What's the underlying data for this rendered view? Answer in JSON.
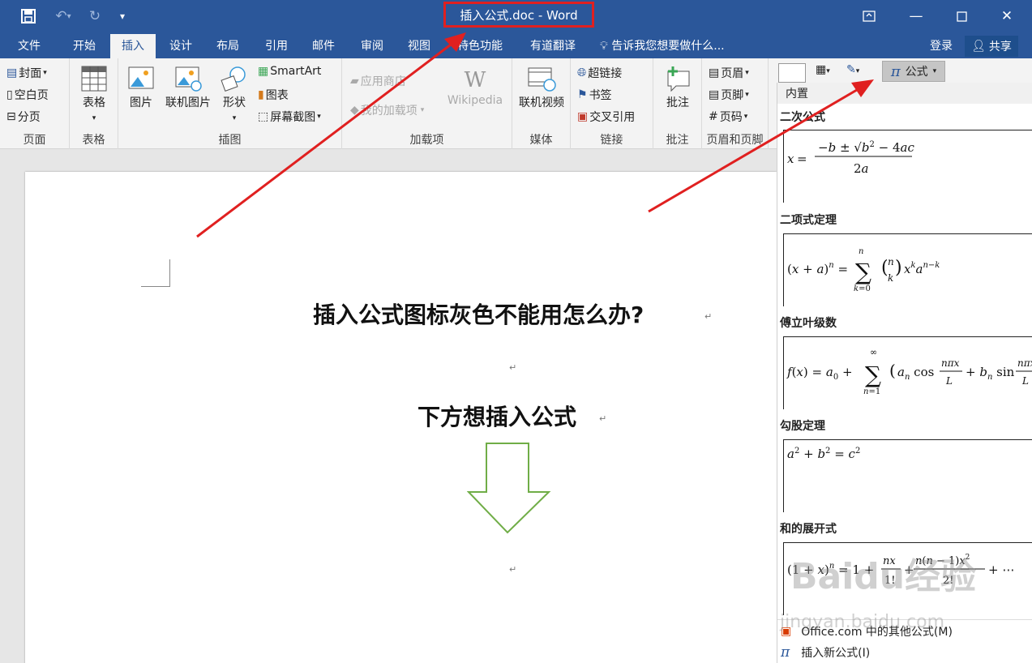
{
  "titlebar": {
    "doc_title": "插入公式.doc - Word",
    "save_icon": "save-icon",
    "undo_icon": "undo-icon",
    "redo_icon": "redo-icon",
    "customize_icon": "customize-icon"
  },
  "tabs": [
    {
      "label": "文件"
    },
    {
      "label": "开始"
    },
    {
      "label": "插入",
      "active": true
    },
    {
      "label": "设计"
    },
    {
      "label": "布局"
    },
    {
      "label": "引用"
    },
    {
      "label": "邮件"
    },
    {
      "label": "审阅"
    },
    {
      "label": "视图"
    },
    {
      "label": "特色功能"
    },
    {
      "label": "有道翻译"
    }
  ],
  "tell_me": "告诉我您想要做什么...",
  "login": "登录",
  "share": "共享",
  "ribbon": {
    "pages": {
      "cover": "封面",
      "blank": "空白页",
      "break": "分页",
      "label": "页面"
    },
    "tables": {
      "table": "表格",
      "label": "表格"
    },
    "illustrations": {
      "picture": "图片",
      "online_picture": "联机图片",
      "shapes": "形状",
      "smartart": "SmartArt",
      "chart": "图表",
      "screenshot": "屏幕截图",
      "label": "插图"
    },
    "addins": {
      "store": "应用商店",
      "my_addins": "我的加载项",
      "wikipedia": "Wikipedia",
      "label": "加载项"
    },
    "media": {
      "online_video": "联机视频",
      "label": "媒体"
    },
    "links": {
      "hyperlink": "超链接",
      "bookmark": "书签",
      "crossref": "交叉引用",
      "label": "链接"
    },
    "comments": {
      "comment": "批注",
      "label": "批注"
    },
    "header_footer": {
      "header": "页眉",
      "footer": "页脚",
      "page_number": "页码",
      "label": "页眉和页脚"
    },
    "symbols": {
      "formula": "公式"
    }
  },
  "document": {
    "heading1": "插入公式图标灰色不能用怎么办?",
    "heading2": "下方想插入公式",
    "para_mark": "↵"
  },
  "gallery": {
    "header": "内置",
    "items": [
      {
        "title": "二次公式"
      },
      {
        "title": "二项式定理"
      },
      {
        "title": "傅立叶级数"
      },
      {
        "title": "勾股定理"
      },
      {
        "title": "和的展开式"
      }
    ],
    "footer": [
      {
        "label": "Office.com 中的其他公式(M)"
      },
      {
        "label": "插入新公式(I)"
      }
    ]
  },
  "watermark": {
    "text": "Baidu经验",
    "sub": "jingyan.baidu.com"
  },
  "colors": {
    "accent": "#2b579a",
    "annotation": "#e02020",
    "arrow_outline": "#70ad47"
  }
}
